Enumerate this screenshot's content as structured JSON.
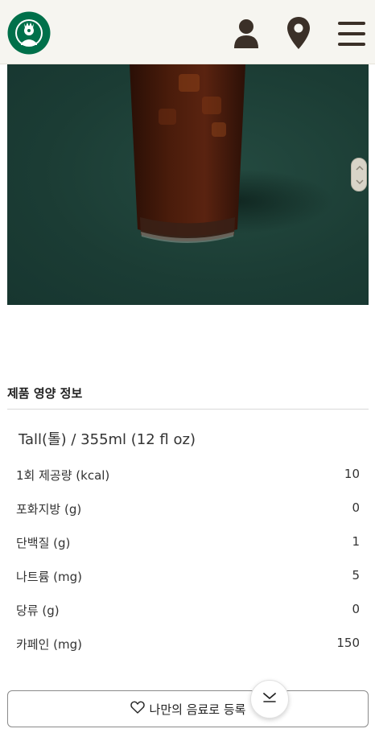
{
  "header": {
    "logo": "starbucks-siren-logo",
    "icons": [
      "user-icon",
      "location-pin-icon",
      "menu-icon"
    ]
  },
  "colors": {
    "header_bg": "#f6f5f0",
    "hero_bg": "#1b3c34",
    "text": "#222222",
    "divider": "#d9d9d9",
    "logo_green": "#00704a"
  },
  "nutrition": {
    "title": "제품 영양 정보",
    "size": "Tall(톨) / 355ml (12 fl oz)",
    "rows": [
      {
        "label": "1회 제공량 (kcal)",
        "value": "10"
      },
      {
        "label": "포화지방 (g)",
        "value": "0"
      },
      {
        "label": "단백질 (g)",
        "value": "1"
      },
      {
        "label": "나트륨 (mg)",
        "value": "5"
      },
      {
        "label": "당류 (g)",
        "value": "0"
      },
      {
        "label": "카페인 (mg)",
        "value": "150"
      }
    ]
  },
  "actions": {
    "register_label": "나만의 음료로 등록",
    "register_icon": "heart-outline-icon",
    "scroll_icon": "chevron-down-icon"
  }
}
